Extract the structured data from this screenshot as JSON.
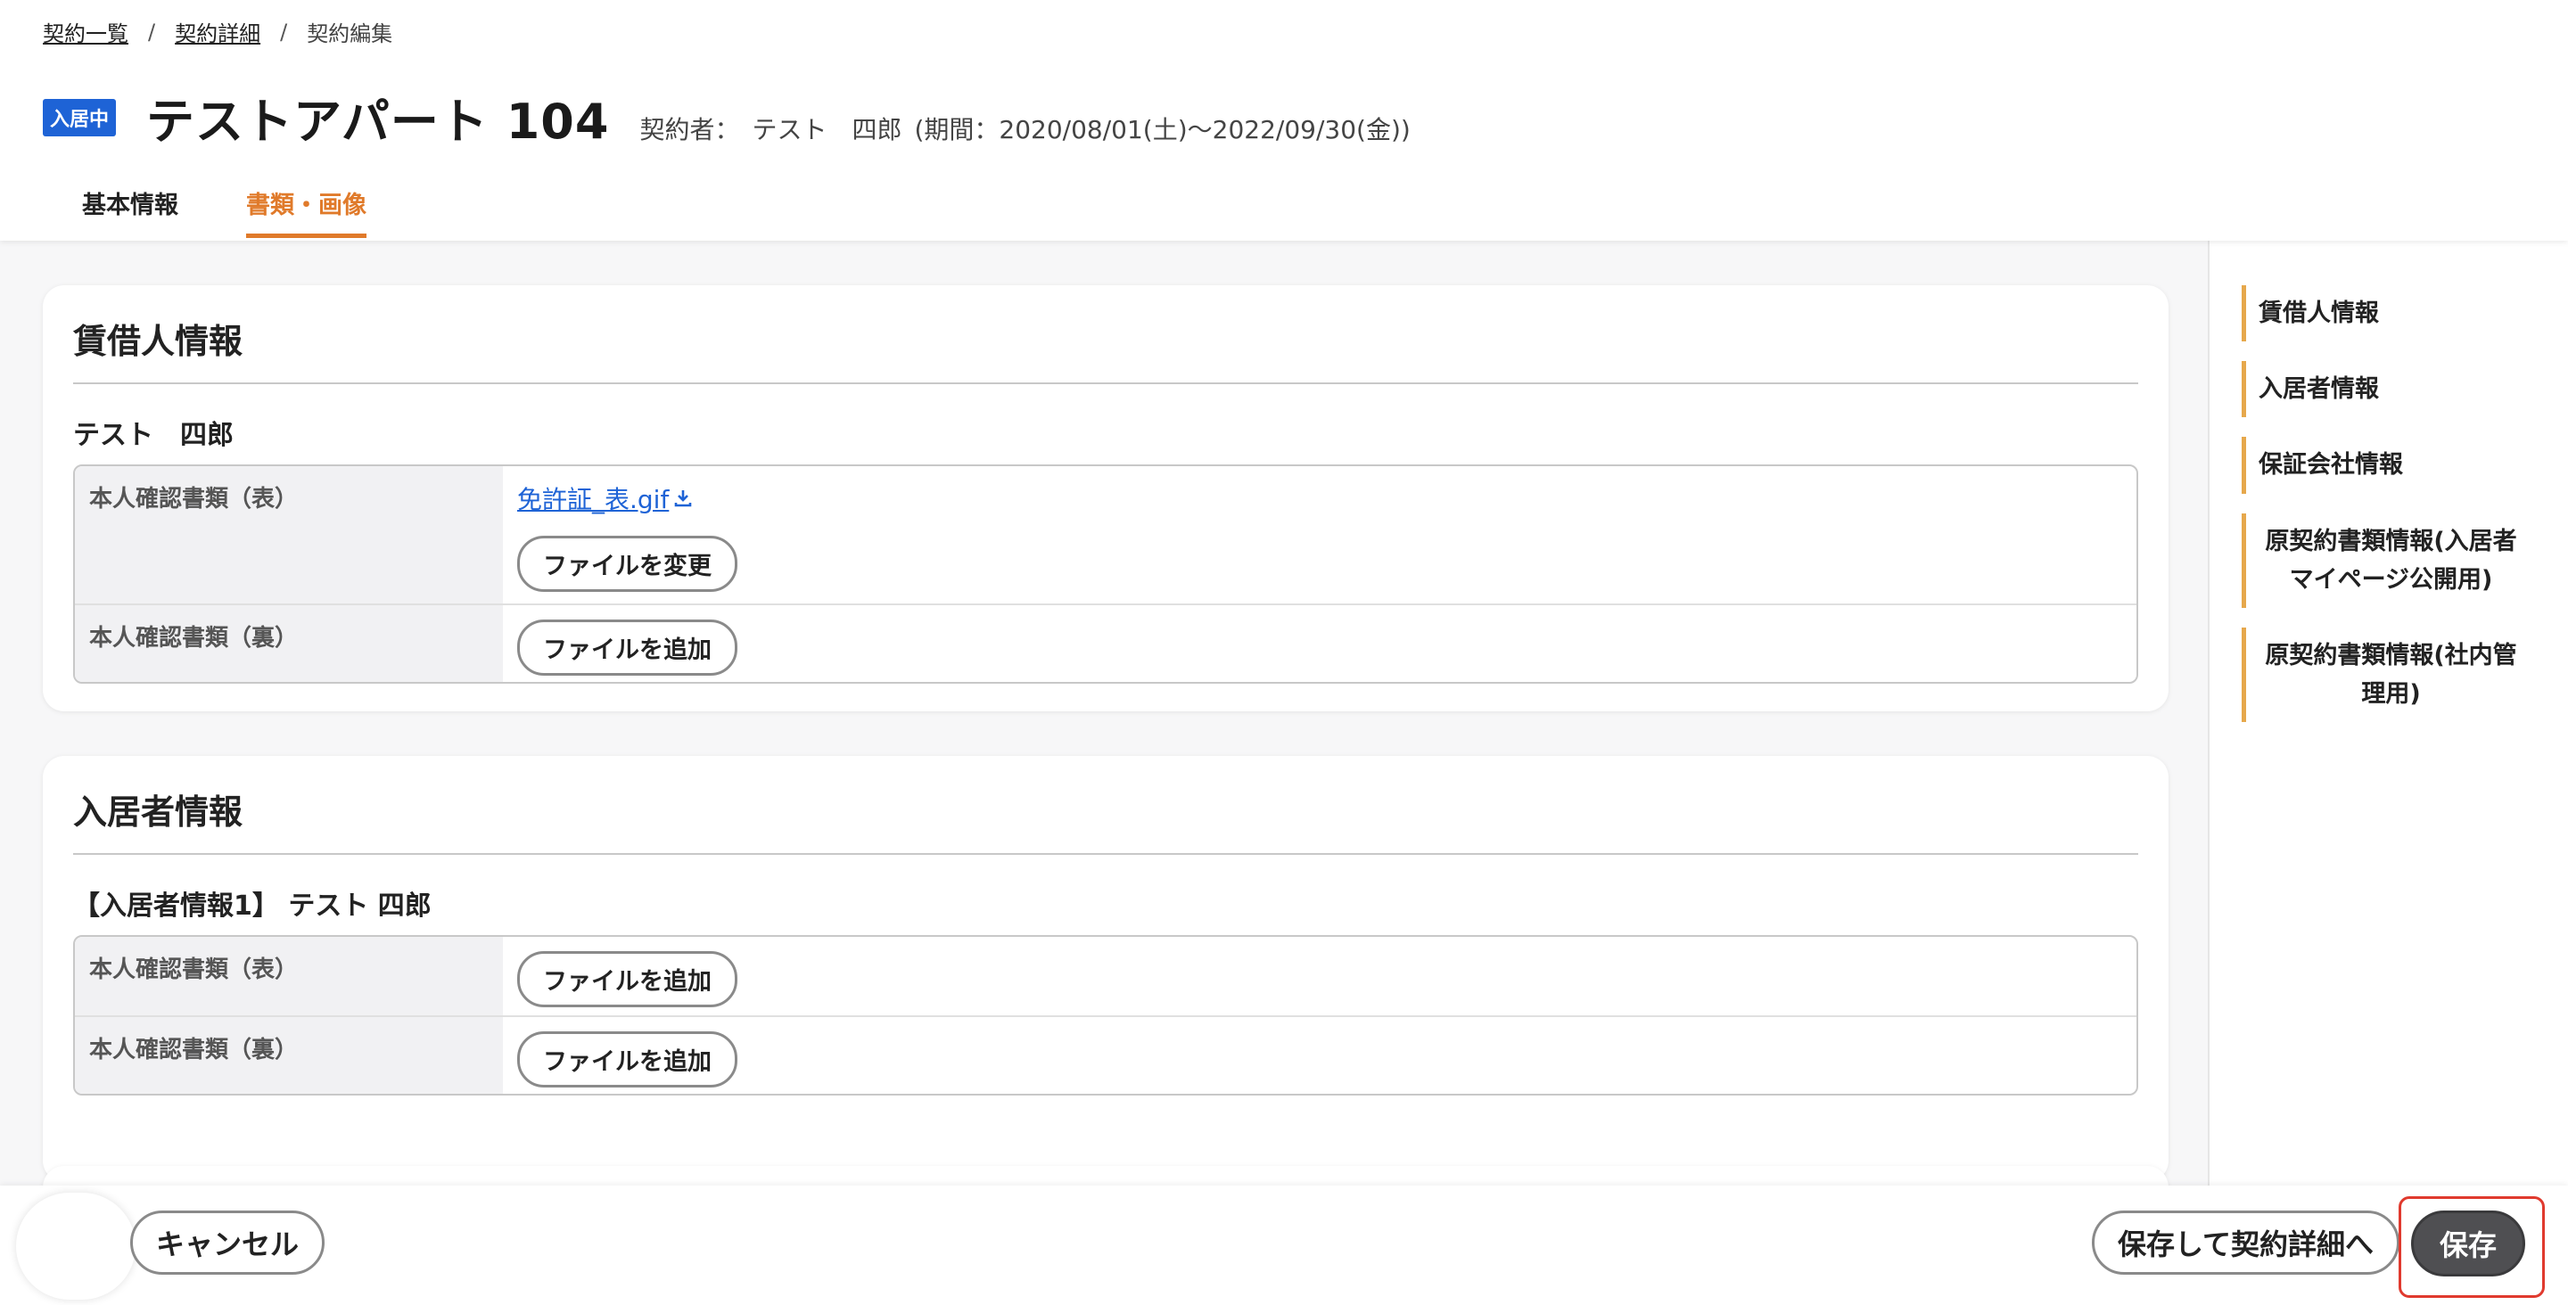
{
  "breadcrumb": {
    "items": [
      {
        "label": "契約一覧"
      },
      {
        "label": "契約詳細"
      }
    ],
    "separator": "/",
    "current": "契約編集"
  },
  "header": {
    "status_badge": "入居中",
    "title": "テストアパート 104",
    "contractor_label": "契約者：",
    "contractor_name": "テスト　四郎",
    "period": "(期間：2020/08/01(土)〜2022/09/30(金))"
  },
  "tabs": [
    {
      "label": "基本情報",
      "active": false
    },
    {
      "label": "書類・画像",
      "active": true
    }
  ],
  "sections": {
    "lessee": {
      "title": "賃借人情報",
      "person_name": "テスト　四郎",
      "rows": [
        {
          "label": "本人確認書類（表）",
          "file_name": "免許証_表.gif",
          "button": "ファイルを変更"
        },
        {
          "label": "本人確認書類（裏）",
          "button": "ファイルを追加"
        }
      ]
    },
    "resident": {
      "title": "入居者情報",
      "person_name": "【入居者情報1】 テスト 四郎",
      "rows": [
        {
          "label": "本人確認書類（表）",
          "button": "ファイルを追加"
        },
        {
          "label": "本人確認書類（裏）",
          "button": "ファイルを追加"
        }
      ]
    }
  },
  "right_nav": {
    "items": [
      "賃借人情報",
      "入居者情報",
      "保証会社情報",
      "原契約書類情報(入居者マイページ公開用)",
      "原契約書類情報(社内管理用)"
    ]
  },
  "footer": {
    "cancel_label": "キャンセル",
    "save_detail_label": "保存して契約詳細へ",
    "save_label": "保存"
  },
  "colors": {
    "accent": "#e07a2a",
    "badge": "#1e63d6",
    "link": "#1e63d6",
    "nav_bar": "#e6a84c",
    "highlight": "#e03a2e",
    "save_bg": "#4f4f52"
  }
}
